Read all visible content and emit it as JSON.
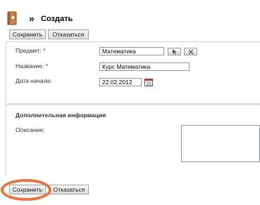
{
  "header": {
    "icon": "book-icon",
    "arrow": "»",
    "title": "Создать"
  },
  "toolbar_top": {
    "save_label": "Сохранить",
    "cancel_label": "Отказаться"
  },
  "form": {
    "subject": {
      "label": "Предмет:",
      "required_mark": "*",
      "value": "Математика"
    },
    "name": {
      "label": "Название:",
      "required_mark": "*",
      "value": "Курс Математика"
    },
    "start_date": {
      "label": "Дата начала:",
      "value": "22.02.2012",
      "icon": "calendar-icon"
    },
    "subject_buttons": {
      "select_icon": "cursor-icon",
      "clear_icon": "close-icon"
    }
  },
  "additional": {
    "section_title": "Дополнительная информация",
    "description_label": "Описание:",
    "description_value": ""
  },
  "toolbar_bottom": {
    "save_label": "Сохранить",
    "cancel_label": "Отказаться"
  },
  "colors": {
    "highlight": "#e8743a",
    "required": "#dd0000",
    "divider": "#dde3ea"
  }
}
